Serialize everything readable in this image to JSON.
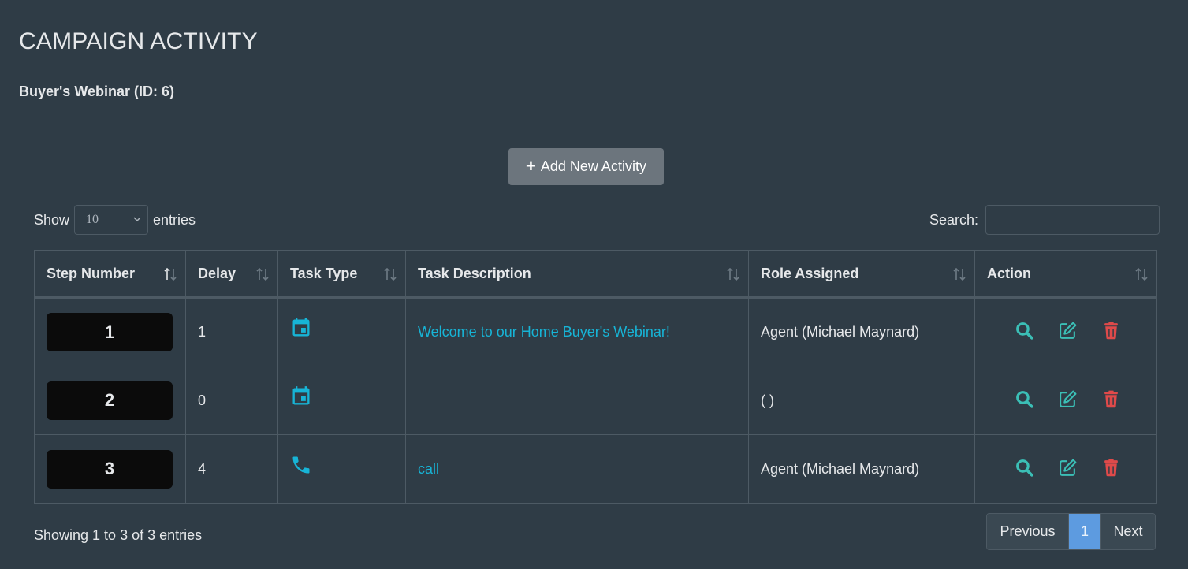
{
  "header": {
    "title": "CAMPAIGN ACTIVITY",
    "campaign": "Buyer's Webinar (ID: 6)"
  },
  "toolbar": {
    "add_label": "Add New Activity"
  },
  "length_control": {
    "show_label": "Show",
    "selected": "10",
    "entries_label": "entries"
  },
  "search": {
    "label": "Search:",
    "value": ""
  },
  "table": {
    "columns": [
      "Step Number",
      "Delay",
      "Task Type",
      "Task Description",
      "Role Assigned",
      "Action"
    ],
    "rows": [
      {
        "step": "1",
        "delay": "1",
        "task_type": "calendar-icon",
        "description": "Welcome to our Home Buyer's Webinar!",
        "role": "Agent (Michael Maynard)"
      },
      {
        "step": "2",
        "delay": "0",
        "task_type": "calendar-icon",
        "description": "",
        "role": "( )"
      },
      {
        "step": "3",
        "delay": "4",
        "task_type": "phone-icon",
        "description": "call",
        "role": "Agent (Michael Maynard)"
      }
    ]
  },
  "footer": {
    "info": "Showing 1 to 3 of 3 entries",
    "pagination": {
      "previous": "Previous",
      "current": "1",
      "next": "Next"
    }
  },
  "colors": {
    "background": "#2f3c46",
    "accent_teal": "#17b4d6",
    "action_teal": "#3bbfb6",
    "delete_red": "#e04a4a",
    "active_page": "#5d9be0"
  }
}
